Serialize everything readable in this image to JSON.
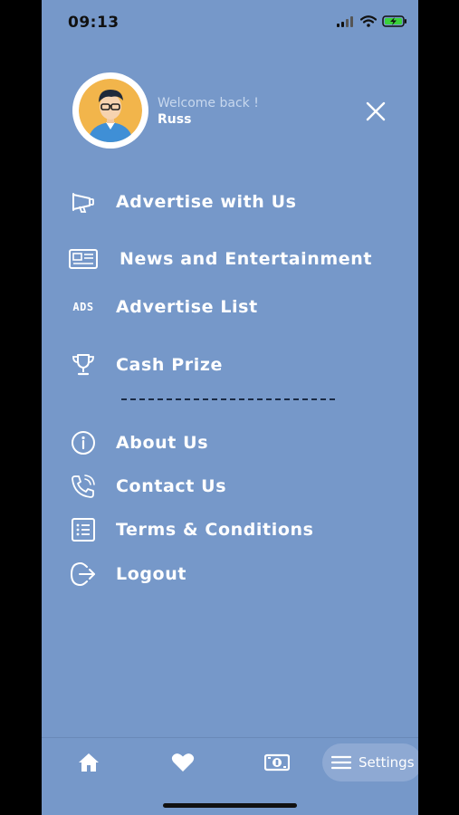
{
  "status_bar": {
    "time": "09:13"
  },
  "profile": {
    "welcome": "Welcome back !",
    "name": "Russ"
  },
  "menu": {
    "advertise": "Advertise with Us",
    "news": "News and Entertainment",
    "advertise_list": "Advertise List",
    "ads_icon_text": "ADS",
    "cash_prize": "Cash Prize",
    "about": "About Us",
    "contact": "Contact Us",
    "terms": "Terms & Conditions",
    "logout": "Logout"
  },
  "bottom_nav": {
    "settings_label": "Settings"
  },
  "colors": {
    "background": "#7698c9",
    "text": "#ffffff",
    "pill": "#8ea9d3"
  }
}
